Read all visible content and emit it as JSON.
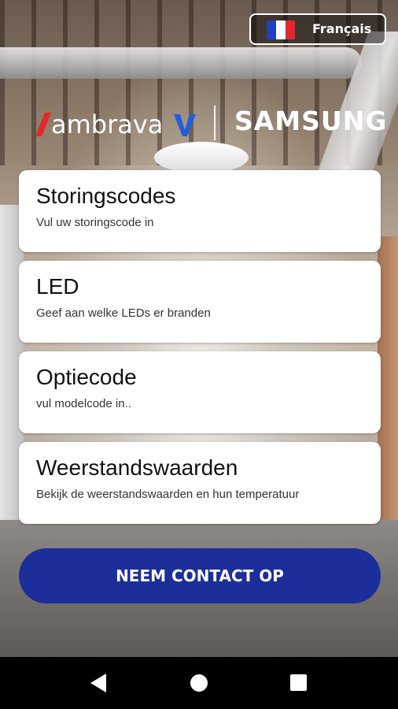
{
  "language_button": {
    "label": "Français",
    "flag_colors": [
      "#1f3fbf",
      "#ffffff",
      "#e4262c"
    ]
  },
  "logos": {
    "left_brand": "ambravav",
    "right_brand": "SAMSUNG",
    "left_brand_colors": {
      "primary": "#ffffff",
      "accent": "#e4262c",
      "v_accent": "#1e5fd9"
    }
  },
  "menu": [
    {
      "title": "Storingscodes",
      "subtitle": "Vul uw storingscode in"
    },
    {
      "title": "LED",
      "subtitle": "Geef aan welke LEDs er branden"
    },
    {
      "title": "Optiecode",
      "subtitle": "vul modelcode in.."
    },
    {
      "title": "Weerstandswaarden",
      "subtitle": "Bekijk de weerstandswaarden en hun temperatuur"
    }
  ],
  "contact_button": {
    "label": "NEEM CONTACT OP",
    "color": "#1c2e9a"
  },
  "navbar": {
    "icons": [
      "back-icon",
      "home-icon",
      "recents-icon"
    ]
  }
}
